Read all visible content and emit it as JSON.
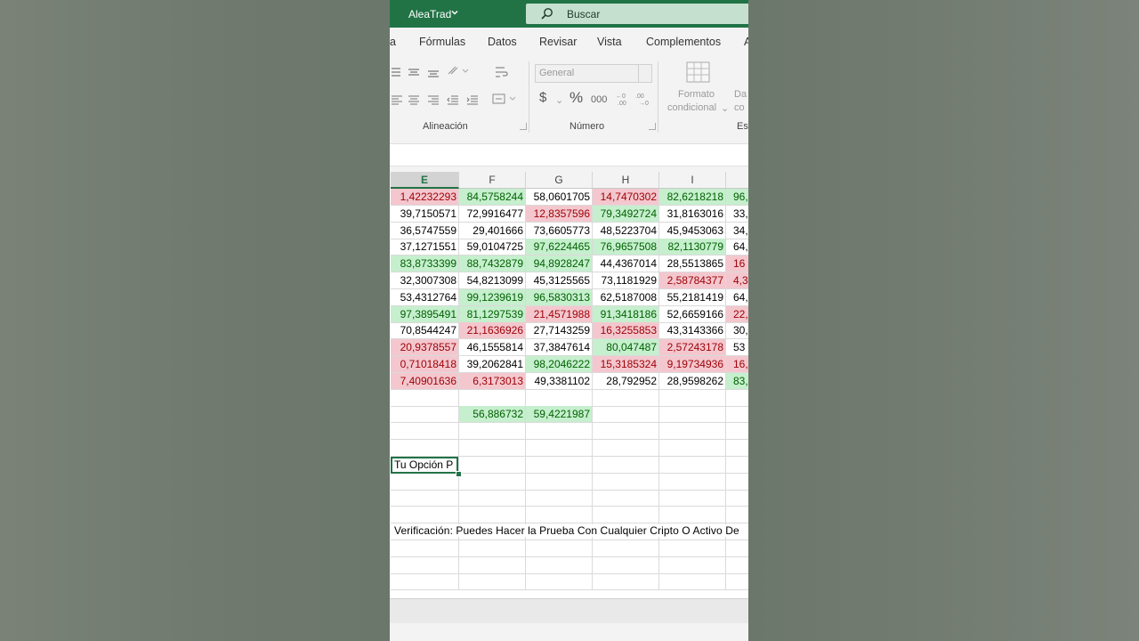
{
  "titlebar": {
    "app_name": "AleaTrad",
    "search_label": "Buscar"
  },
  "tabs": [
    "a",
    "Fórmulas",
    "Datos",
    "Revisar",
    "Vista",
    "Complementos",
    "A"
  ],
  "ribbon": {
    "groups": {
      "alignment": "Alineación",
      "number": "Número",
      "styles": "Es"
    },
    "number_format": "General",
    "conditional_format_line1": "Formato",
    "conditional_format_line2": "condicional",
    "next_button_line1": "Da",
    "next_button_line2": "co",
    "currency_symbol": "$",
    "percent_symbol": "%",
    "thousands_symbol": "000"
  },
  "columns": [
    "E",
    "F",
    "G",
    "H",
    "I",
    ""
  ],
  "selected_column": "E",
  "rows": [
    [
      [
        "1,42232293",
        "r"
      ],
      [
        "84,5758244",
        "g"
      ],
      [
        "58,0601705",
        ""
      ],
      [
        "14,7470302",
        "r"
      ],
      [
        "82,6218218",
        "g"
      ],
      [
        "96,",
        "g"
      ]
    ],
    [
      [
        "39,7150571",
        ""
      ],
      [
        "72,9916477",
        ""
      ],
      [
        "12,8357596",
        "r"
      ],
      [
        "79,3492724",
        "g"
      ],
      [
        "31,8163016",
        ""
      ],
      [
        "33,",
        ""
      ]
    ],
    [
      [
        "36,5747559",
        ""
      ],
      [
        "29,401666",
        ""
      ],
      [
        "73,6605773",
        ""
      ],
      [
        "48,5223704",
        ""
      ],
      [
        "45,9453063",
        ""
      ],
      [
        "34,",
        ""
      ]
    ],
    [
      [
        "37,1271551",
        ""
      ],
      [
        "59,0104725",
        ""
      ],
      [
        "97,6224465",
        "g"
      ],
      [
        "76,9657508",
        "g"
      ],
      [
        "82,1130779",
        "g"
      ],
      [
        "64,",
        ""
      ]
    ],
    [
      [
        "83,8733399",
        "g"
      ],
      [
        "88,7432879",
        "g"
      ],
      [
        "94,8928247",
        "g"
      ],
      [
        "44,4367014",
        ""
      ],
      [
        "28,5513865",
        ""
      ],
      [
        "16",
        "r"
      ]
    ],
    [
      [
        "32,3007308",
        ""
      ],
      [
        "54,8213099",
        ""
      ],
      [
        "45,3125565",
        ""
      ],
      [
        "73,1181929",
        ""
      ],
      [
        "2,58784377",
        "r"
      ],
      [
        "4,3",
        "r"
      ]
    ],
    [
      [
        "53,4312764",
        ""
      ],
      [
        "99,1239619",
        "g"
      ],
      [
        "96,5830313",
        "g"
      ],
      [
        "62,5187008",
        ""
      ],
      [
        "55,2181419",
        ""
      ],
      [
        "64,",
        ""
      ]
    ],
    [
      [
        "97,3895491",
        "g"
      ],
      [
        "81,1297539",
        "g"
      ],
      [
        "21,4571988",
        "r"
      ],
      [
        "91,3418186",
        "g"
      ],
      [
        "52,6659166",
        ""
      ],
      [
        "22,",
        "r"
      ]
    ],
    [
      [
        "70,8544247",
        ""
      ],
      [
        "21,1636926",
        "r"
      ],
      [
        "27,7143259",
        ""
      ],
      [
        "16,3255853",
        "r"
      ],
      [
        "43,3143366",
        ""
      ],
      [
        "30,",
        ""
      ]
    ],
    [
      [
        "20,9378557",
        "r"
      ],
      [
        "46,1555814",
        ""
      ],
      [
        "37,3847614",
        ""
      ],
      [
        "80,047487",
        "g"
      ],
      [
        "2,57243178",
        "r"
      ],
      [
        "53",
        ""
      ]
    ],
    [
      [
        "0,71018418",
        "r"
      ],
      [
        "39,2062841",
        ""
      ],
      [
        "98,2046222",
        "g"
      ],
      [
        "15,3185324",
        "r"
      ],
      [
        "9,19734936",
        "r"
      ],
      [
        "16,",
        "r"
      ]
    ],
    [
      [
        "7,40901636",
        "r"
      ],
      [
        "6,3173013",
        "r"
      ],
      [
        "49,3381102",
        ""
      ],
      [
        "28,792952",
        ""
      ],
      [
        "28,9598262",
        ""
      ],
      [
        "83,",
        "g"
      ]
    ]
  ],
  "averages": {
    "F": "56,886732",
    "G": "59,4221987"
  },
  "active_cell_text": "Tu Opción P",
  "verification_text": "Verificación: Puedes Hacer la Prueba Con Cualquier Cripto O Activo De"
}
